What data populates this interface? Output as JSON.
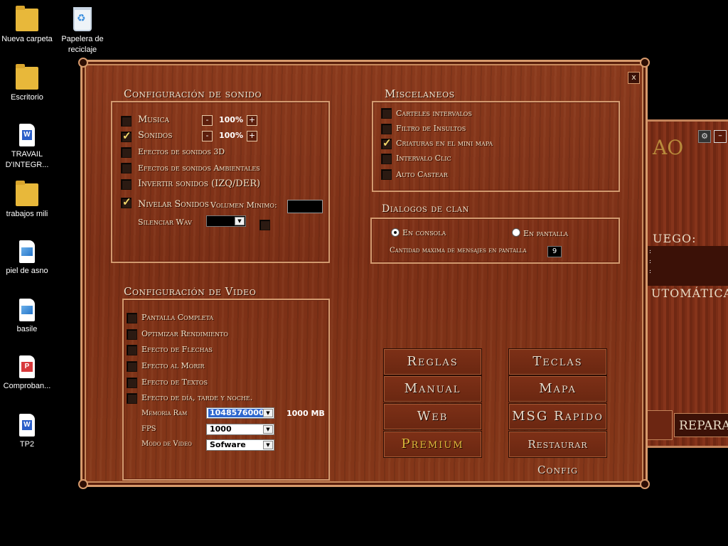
{
  "desktop": {
    "icons": [
      {
        "label": "Nueva carpeta",
        "icon": "folder-icon"
      },
      {
        "label": "Papelera de reciclaje",
        "icon": "recycle-bin-icon"
      },
      {
        "label": "Escritorio",
        "icon": "folder-icon"
      },
      {
        "label": "TRAVAIL D'INTEGR...",
        "icon": "word-document-icon"
      },
      {
        "label": "trabajos mili",
        "icon": "folder-icon"
      },
      {
        "label": "piel de asno",
        "icon": "image-file-icon"
      },
      {
        "label": "basile",
        "icon": "image-file-icon"
      },
      {
        "label": "Comproban...",
        "icon": "pdf-document-icon"
      },
      {
        "label": "TP2",
        "icon": "word-document-icon"
      }
    ]
  },
  "background_window": {
    "logo": "AO",
    "section": "UEGO:",
    "dots": [
      ":",
      ":",
      ":"
    ],
    "auto_label": "UTOMÁTICAS",
    "repair_label": "REPARA"
  },
  "config": {
    "close_label": "x",
    "sound": {
      "title": "Configuración de sonido",
      "musica": {
        "label": "Musica",
        "checked": false,
        "value": "100%"
      },
      "sonidos": {
        "label": "Sonidos",
        "checked": true,
        "value": "100%"
      },
      "efectos3d": {
        "label": "Efectos de sonidos 3D",
        "checked": false
      },
      "ambientales": {
        "label": "Efectos de sonidos Ambientales",
        "checked": false
      },
      "invertir": {
        "label": "Invertir sonidos (IZQ/DER)",
        "checked": false
      },
      "nivelar": {
        "label": "Nivelar Sonidos",
        "checked": true
      },
      "volumen_label": "Volumen Minimo:",
      "silenciar_label": "Silenciar Wav",
      "minus": "-",
      "plus": "+"
    },
    "misc": {
      "title": "Miscelaneos",
      "items": [
        {
          "label": "Carteles intervalos",
          "checked": false
        },
        {
          "label": "Filtro de Insultos",
          "checked": false
        },
        {
          "label": "Criaturas en el mini mapa",
          "checked": true
        },
        {
          "label": "Intervalo Clic",
          "checked": false
        },
        {
          "label": "Auto Castear",
          "checked": false
        }
      ]
    },
    "clan": {
      "title": "Dialogos de clan",
      "consola": {
        "label": "En consola",
        "selected": true
      },
      "pantalla": {
        "label": "En pantalla",
        "selected": false
      },
      "max_label": "Cantidad maxima de mensajes en pantalla",
      "max_value": "9"
    },
    "video": {
      "title": "Configuración de Video",
      "items": [
        {
          "label": "Pantalla Completa",
          "checked": false
        },
        {
          "label": "Optimizar Rendimiento",
          "checked": false
        },
        {
          "label": "Efecto de Flechas",
          "checked": false
        },
        {
          "label": "Efecto al Morir",
          "checked": false
        },
        {
          "label": "Efecto de Textos",
          "checked": false
        },
        {
          "label": "Efecto de día, tarde y noche.",
          "checked": false
        }
      ],
      "ram_label": "Memoria Ram",
      "ram_value": "1048576000",
      "ram_mb": "1000 MB",
      "fps_label": "FPS",
      "fps_value": "1000",
      "modo_label": "Modo de Video",
      "modo_value": "Sofware"
    },
    "buttons": {
      "reglas": "Reglas",
      "teclas": "Teclas",
      "manual": "Manual",
      "mapa": "Mapa",
      "web": "Web",
      "msg": "MSG Rapido",
      "premium": "Premium",
      "restaurar": "Restaurar Config"
    }
  },
  "colors": {
    "window_wood": "#7b2f16",
    "frame": "#d79a6c",
    "label_text": "#f0e2c8",
    "check_gold": "#f2d76a",
    "premium_gold": "#e2bd3d",
    "selection_blue": "#2e68cf"
  }
}
